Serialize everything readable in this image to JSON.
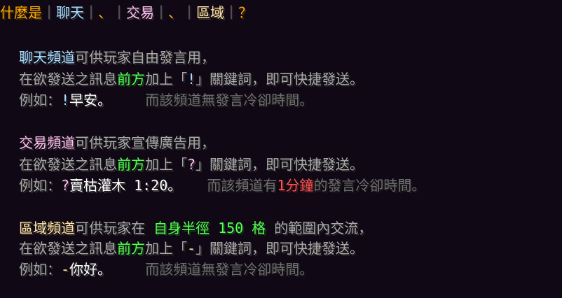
{
  "title": [
    {
      "text": "什麼是",
      "color": "orange"
    },
    {
      "text": "｜",
      "color": "sep"
    },
    {
      "text": "聊天",
      "color": "blue"
    },
    {
      "text": "｜",
      "color": "sep"
    },
    {
      "text": "、",
      "color": "dot"
    },
    {
      "text": "｜",
      "color": "sep"
    },
    {
      "text": "交易",
      "color": "pink"
    },
    {
      "text": "｜",
      "color": "sep"
    },
    {
      "text": "、",
      "color": "dot"
    },
    {
      "text": "｜",
      "color": "sep"
    },
    {
      "text": "區域",
      "color": "beige"
    },
    {
      "text": "｜",
      "color": "sep"
    },
    {
      "text": "？",
      "color": "orange"
    }
  ],
  "lines": [
    [
      {
        "text": "聊天頻道",
        "color": "blue"
      },
      {
        "text": "可供玩家自由發言用，",
        "color": "gray"
      }
    ],
    [
      {
        "text": "在欲發送之訊息",
        "color": "gray"
      },
      {
        "text": "前方",
        "color": "green"
      },
      {
        "text": "加上「",
        "color": "gray"
      },
      {
        "text": "!",
        "color": "blue"
      },
      {
        "text": "」關鍵詞，即可快捷發送。",
        "color": "gray"
      }
    ],
    [
      {
        "text": "例如：",
        "color": "gray"
      },
      {
        "text": "!",
        "color": "blue"
      },
      {
        "text": "早安。",
        "color": "white"
      },
      {
        "text": "    而該頻道無發言冷卻時間。",
        "color": "dim"
      }
    ],
    [
      {
        "text": "交易頻道",
        "color": "pink"
      },
      {
        "text": "可供玩家宣傳廣告用，",
        "color": "gray"
      }
    ],
    [
      {
        "text": "在欲發送之訊息",
        "color": "gray"
      },
      {
        "text": "前方",
        "color": "green"
      },
      {
        "text": "加上「",
        "color": "gray"
      },
      {
        "text": "?",
        "color": "pink"
      },
      {
        "text": "」關鍵詞，即可快捷發送。",
        "color": "gray"
      }
    ],
    [
      {
        "text": "例如：",
        "color": "gray"
      },
      {
        "text": "?",
        "color": "pink"
      },
      {
        "text": "賣枯灌木 1:20。",
        "color": "white"
      },
      {
        "text": "   而該頻道有",
        "color": "dim"
      },
      {
        "text": "1分鐘",
        "color": "red"
      },
      {
        "text": "的發言冷卻時間。",
        "color": "dim"
      }
    ],
    [
      {
        "text": "區域頻道",
        "color": "beige"
      },
      {
        "text": "可供玩家在 ",
        "color": "gray"
      },
      {
        "text": "自身半徑 150 格",
        "color": "green"
      },
      {
        "text": " 的範圍內交流，",
        "color": "gray"
      }
    ],
    [
      {
        "text": "在欲發送之訊息",
        "color": "gray"
      },
      {
        "text": "前方",
        "color": "green"
      },
      {
        "text": "加上「",
        "color": "gray"
      },
      {
        "text": "-",
        "color": "beige"
      },
      {
        "text": "」關鍵詞，即可快捷發送。",
        "color": "gray"
      }
    ],
    [
      {
        "text": "例如：",
        "color": "gray"
      },
      {
        "text": "-",
        "color": "beige"
      },
      {
        "text": "你好。",
        "color": "white"
      },
      {
        "text": "    而該頻道無發言冷卻時間。",
        "color": "dim"
      }
    ]
  ],
  "colors": {
    "orange": "#ffaa00",
    "blue": "#aaddff",
    "pink": "#ffc4f0",
    "beige": "#ffe4a8",
    "green": "#55ff55",
    "red": "#ff5555",
    "gray": "#aaaaaa",
    "dim": "#707070",
    "white": "#ffffff",
    "background": "#100814"
  }
}
